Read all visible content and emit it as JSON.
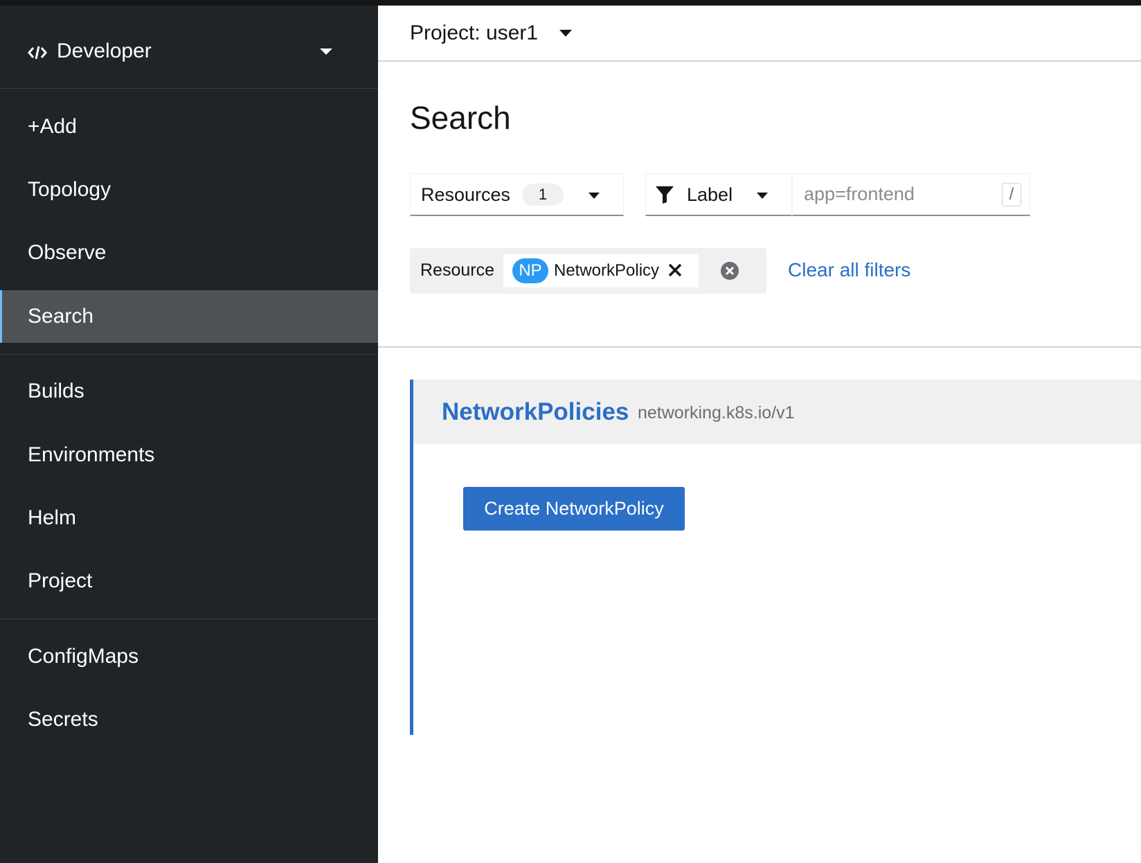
{
  "perspective": {
    "label": "Developer",
    "icon": "code-icon"
  },
  "nav": {
    "group1": [
      "+Add",
      "Topology",
      "Observe",
      "Search"
    ],
    "group2": [
      "Builds",
      "Environments",
      "Helm",
      "Project"
    ],
    "group3": [
      "ConfigMaps",
      "Secrets"
    ],
    "active": "Search"
  },
  "project_bar": {
    "label": "Project: user1"
  },
  "page": {
    "title": "Search"
  },
  "toolbar": {
    "resources_label": "Resources",
    "resources_count": "1",
    "label_filter": "Label",
    "label_input_placeholder": "app=frontend",
    "kbd_hint": "/"
  },
  "filters": {
    "category": "Resource",
    "chip_badge": "NP",
    "chip_label": "NetworkPolicy",
    "clear_all": "Clear all filters"
  },
  "result": {
    "kind_plural": "NetworkPolicies",
    "api_version": "networking.k8s.io/v1",
    "create_button": "Create NetworkPolicy"
  },
  "colors": {
    "sidebar_bg": "#212427",
    "active_nav_bg": "#4f5255",
    "accent_blue": "#2b6fc6",
    "np_badge": "#2b9af3"
  }
}
